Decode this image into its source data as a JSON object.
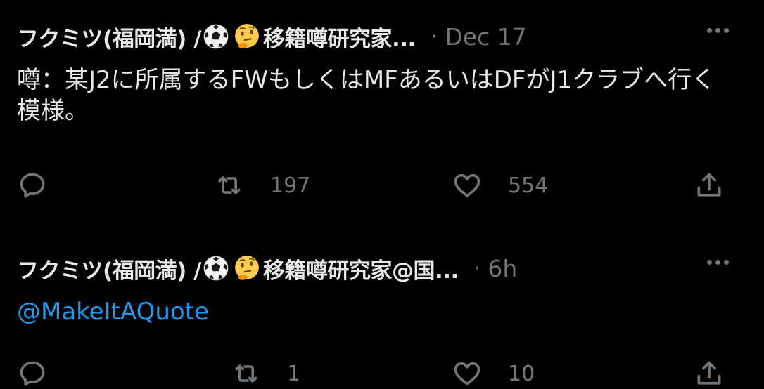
{
  "tweets": [
    {
      "display_name": "フクミツ(福岡満) / ",
      "handle_tail": "移籍噂研究家...",
      "time": "Dec 17",
      "separator": "·",
      "text": "噂：某J2に所属するFWもしくはMFあるいはDFがJ1クラブへ行く模様。",
      "retweets": "197",
      "likes": "554"
    },
    {
      "display_name": "フクミツ(福岡満) / ",
      "handle_tail": "移籍噂研究家@国...",
      "time": "6h",
      "separator": "·",
      "text": "@MakeItAQuote",
      "retweets": "1",
      "likes": "10"
    }
  ],
  "colors": {
    "background": "#000000",
    "text": "#e7e9ea",
    "muted": "#71767b",
    "link": "#1d9bf0"
  },
  "icons": [
    "soccer-ball-icon",
    "thinking-face-icon",
    "more-icon",
    "reply-icon",
    "retweet-icon",
    "like-icon",
    "share-icon"
  ]
}
